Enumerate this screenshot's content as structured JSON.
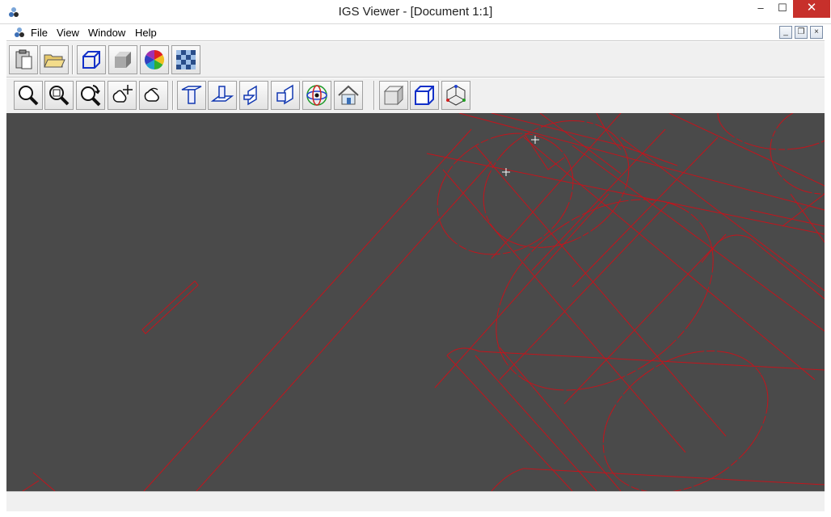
{
  "window": {
    "title": "IGS Viewer - [Document 1:1]",
    "minimize_glyph": "–",
    "maximize_glyph": "☐",
    "close_glyph": "✕"
  },
  "menu": {
    "items": [
      "File",
      "View",
      "Window",
      "Help"
    ],
    "mdi_minimize": "_",
    "mdi_restore": "❐",
    "mdi_close": "×"
  },
  "toolbar_top": {
    "buttons": [
      "paste-icon",
      "open-folder-icon",
      "wireframe-cube-icon",
      "shaded-cube-icon",
      "color-wheel-icon",
      "texture-icon"
    ]
  },
  "toolbar_view": {
    "buttons": [
      "zoom-icon",
      "zoom-window-icon",
      "zoom-previous-icon",
      "pan-icon",
      "rotate-hand-icon",
      "front-view-icon",
      "top-view-icon",
      "side-view-icon",
      "back-view-icon",
      "orbit-icon",
      "home-view-icon",
      "solid-box-icon",
      "wire-box-icon",
      "axes-icon"
    ]
  },
  "colors": {
    "canvas": "#4a4a4a",
    "geometry": "#c4141c",
    "close_button": "#c7302b"
  },
  "status": {
    "text": ""
  }
}
